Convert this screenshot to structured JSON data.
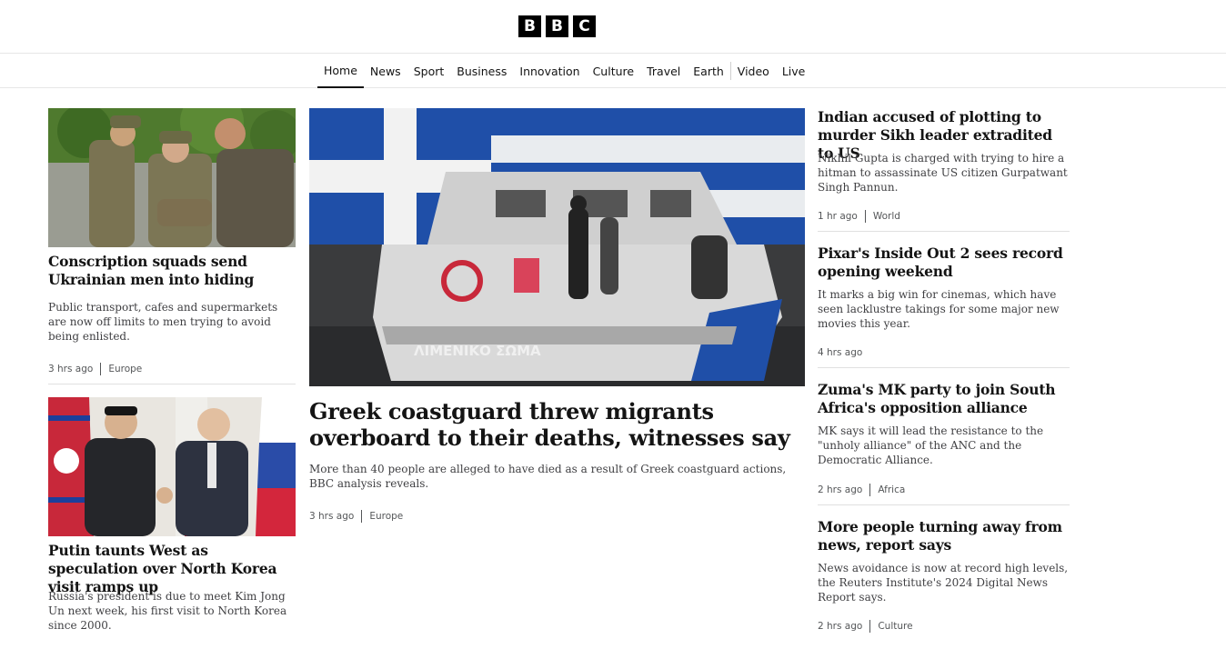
{
  "logo": {
    "letters": [
      "B",
      "B",
      "C"
    ]
  },
  "nav": {
    "items": [
      {
        "label": "Home",
        "active": true
      },
      {
        "label": "News"
      },
      {
        "label": "Sport"
      },
      {
        "label": "Business"
      },
      {
        "label": "Innovation"
      },
      {
        "label": "Culture"
      },
      {
        "label": "Travel"
      },
      {
        "label": "Earth"
      },
      {
        "label": "Video"
      },
      {
        "label": "Live"
      }
    ]
  },
  "left": {
    "story1": {
      "headline": "Conscription squads send Ukrainian men into hiding",
      "summary": "Public transport, cafes and supermarkets are now off limits to men trying to avoid being enlisted.",
      "time": "3 hrs ago",
      "section": "Europe"
    },
    "story2": {
      "headline": "Putin taunts West as speculation over North Korea visit ramps up",
      "summary": "Russia's president is due to meet Kim Jong Un next week, his first visit to North Korea since 2000."
    }
  },
  "lead": {
    "image_text": "ΛΙΜΕΝΙΚΟ ΣΩΜΑ",
    "headline": "Greek coastguard threw migrants overboard to their deaths, witnesses say",
    "summary": "More than 40 people are alleged to have died as a result of Greek coastguard actions, BBC analysis reveals.",
    "time": "3 hrs ago",
    "section": "Europe"
  },
  "right": [
    {
      "headline": "Indian accused of plotting to murder Sikh leader extradited to US",
      "summary": "Nikhil Gupta is charged with trying to hire a hitman to assassinate US citizen Gurpatwant Singh Pannun.",
      "time": "1 hr ago",
      "section": "World"
    },
    {
      "headline": "Pixar's Inside Out 2 sees record opening weekend",
      "summary": "It marks a big win for cinemas, which have seen lacklustre takings for some major new movies this year.",
      "time": "4 hrs ago",
      "section": ""
    },
    {
      "headline": "Zuma's MK party to join South Africa's opposition alliance",
      "summary": "MK says it will lead the resistance to the \"unholy alliance\" of the ANC and the Democratic Alliance.",
      "time": "2 hrs ago",
      "section": "Africa"
    },
    {
      "headline": "More people turning away from news, report says",
      "summary": "News avoidance is now at record high levels, the Reuters Institute's 2024 Digital News Report says.",
      "time": "2 hrs ago",
      "section": "Culture"
    }
  ],
  "colors": {
    "text": "#141414",
    "summary": "#3f3f42",
    "meta": "#545658",
    "greek_blue": "#1f4fa8"
  }
}
